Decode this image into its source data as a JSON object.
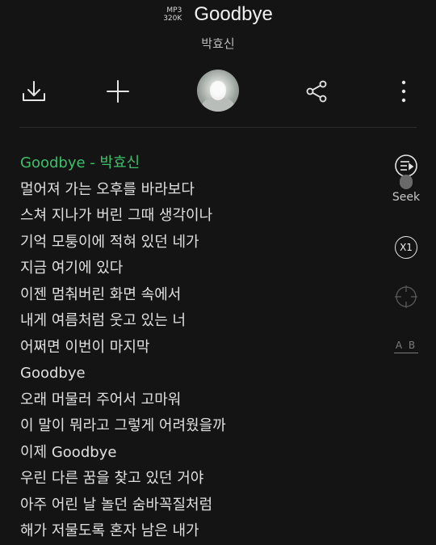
{
  "header": {
    "quality_format": "MP3",
    "quality_bitrate": "320K",
    "title": "Goodbye",
    "artist": "박효신"
  },
  "toolbar": {
    "download_icon": "download-icon",
    "add_icon": "plus-icon",
    "share_icon": "share-icon",
    "more_icon": "more-vertical-icon"
  },
  "side_controls": {
    "lyrics_mode_icon": "list-play-icon",
    "seek_label": "Seek",
    "speed_label": "X1",
    "target_icon": "crosshair-icon",
    "ab_label": "A B"
  },
  "colors": {
    "background": "#141414",
    "current_line": "#3fbf6a",
    "text": "#e0e0e0"
  },
  "lyrics": [
    "Goodbye - 박효신",
    "멀어져 가는 오후를 바라보다",
    "스쳐 지나가 버린 그때 생각이나",
    "기억 모퉁이에 적혀 있던 네가",
    "지금 여기에 있다",
    "이젠 멈춰버린 화면 속에서",
    "내게 여름처럼 웃고 있는 너",
    "어쩌면 이번이 마지막",
    "Goodbye",
    "오래 머물러 주어서 고마워",
    "이 말이 뭐라고 그렇게 어려웠을까",
    "이제 Goodbye",
    "우린 다른 꿈을 찾고 있던 거야",
    "아주 어린 날 놀던 숨바꼭질처럼",
    "해가 저물도록 혼자 남은 내가"
  ]
}
